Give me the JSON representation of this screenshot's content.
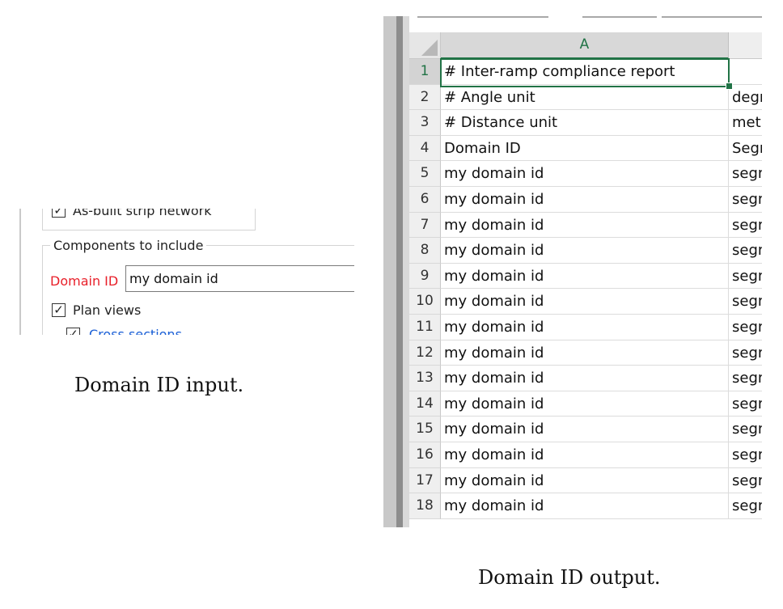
{
  "left_panel": {
    "top_checkbox": {
      "label": "As-built strip network",
      "checked": true
    },
    "group_legend": "Components to include",
    "domain_id": {
      "label": "Domain ID",
      "value": "my domain id"
    },
    "plan_views": {
      "label": "Plan views",
      "checked": true
    },
    "sub_option": {
      "label": "Cross sections",
      "checked": true
    },
    "caption": "Domain ID input."
  },
  "right_panel": {
    "column_a_header": "A",
    "rows": [
      {
        "num": "1",
        "a": "# Inter-ramp compliance report",
        "b": ""
      },
      {
        "num": "2",
        "a": "# Angle unit",
        "b": "degr"
      },
      {
        "num": "3",
        "a": "# Distance unit",
        "b": "metr"
      },
      {
        "num": "4",
        "a": "Domain ID",
        "b": "Segm"
      },
      {
        "num": "5",
        "a": "my domain id",
        "b": "segm"
      },
      {
        "num": "6",
        "a": "my domain id",
        "b": "segm"
      },
      {
        "num": "7",
        "a": "my domain id",
        "b": "segm"
      },
      {
        "num": "8",
        "a": "my domain id",
        "b": "segm"
      },
      {
        "num": "9",
        "a": "my domain id",
        "b": "segm"
      },
      {
        "num": "10",
        "a": "my domain id",
        "b": "segm"
      },
      {
        "num": "11",
        "a": "my domain id",
        "b": "segm"
      },
      {
        "num": "12",
        "a": "my domain id",
        "b": "segm"
      },
      {
        "num": "13",
        "a": "my domain id",
        "b": "segm"
      },
      {
        "num": "14",
        "a": "my domain id",
        "b": "segm"
      },
      {
        "num": "15",
        "a": "my domain id",
        "b": "segm"
      },
      {
        "num": "16",
        "a": "my domain id",
        "b": "segm"
      },
      {
        "num": "17",
        "a": "my domain id",
        "b": "segm"
      },
      {
        "num": "18",
        "a": "my domain id",
        "b": "segm"
      }
    ],
    "active_cell": "A1",
    "caption": "Domain ID output."
  },
  "colors": {
    "excel_green": "#217346",
    "label_red": "#e8202a",
    "link_blue": "#1a5fd6"
  },
  "icons": [
    "checkbox-checked-icon",
    "select-all-corner-icon",
    "fill-handle-icon"
  ]
}
